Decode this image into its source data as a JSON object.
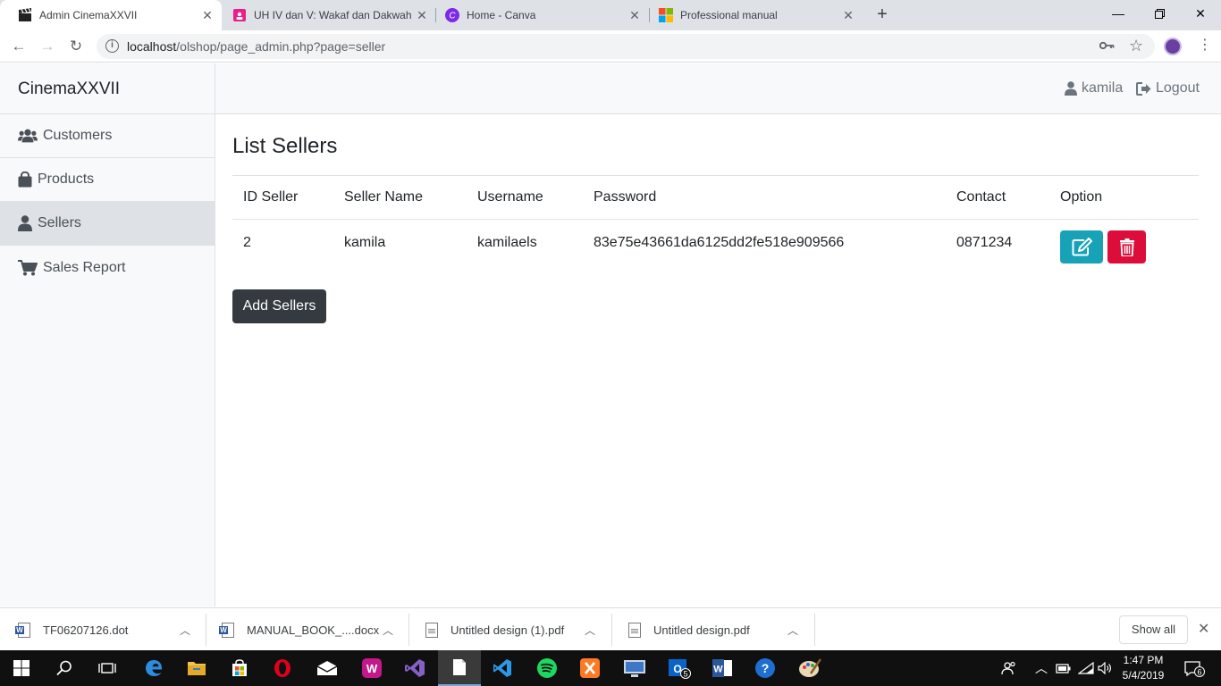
{
  "browser": {
    "tabs": [
      {
        "title": "Admin CinemaXXVII",
        "active": true
      },
      {
        "title": "UH IV dan V: Wakaf dan Dakwah",
        "active": false
      },
      {
        "title": "Home - Canva",
        "active": false
      },
      {
        "title": "Professional manual",
        "active": false
      }
    ],
    "url_host": "localhost",
    "url_path": "/olshop/page_admin.php?page=seller"
  },
  "app": {
    "brand": "CinemaXXVII",
    "sidebar": [
      {
        "label": "Customers",
        "icon": "users-icon"
      },
      {
        "label": "Products",
        "icon": "shopping-bag-icon"
      },
      {
        "label": "Sellers",
        "icon": "user-icon",
        "active": true
      },
      {
        "label": "Sales Report",
        "icon": "shopping-cart-icon"
      }
    ],
    "topbar": {
      "user": "kamila",
      "logout": "Logout"
    },
    "page_title": "List Sellers",
    "table": {
      "headers": [
        "ID Seller",
        "Seller Name",
        "Username",
        "Password",
        "Contact",
        "Option"
      ],
      "rows": [
        {
          "id": "2",
          "name": "kamila",
          "username": "kamilaels",
          "password": "83e75e43661da6125dd2fe518e909566",
          "contact": "0871234"
        }
      ]
    },
    "add_button": "Add Sellers",
    "colors": {
      "edit": "#17a2b8",
      "delete": "#dc0d3a",
      "add": "#343a40"
    }
  },
  "downloads": {
    "items": [
      {
        "name": "TF06207126.dot",
        "type": "word"
      },
      {
        "name": "MANUAL_BOOK_....docx",
        "type": "word"
      },
      {
        "name": "Untitled design (1).pdf",
        "type": "pdf"
      },
      {
        "name": "Untitled design.pdf",
        "type": "pdf"
      }
    ],
    "show_all": "Show all"
  },
  "taskbar": {
    "time": "1:47 PM",
    "date": "5/4/2019",
    "notification_count": "6",
    "outlook_badge": "5"
  }
}
